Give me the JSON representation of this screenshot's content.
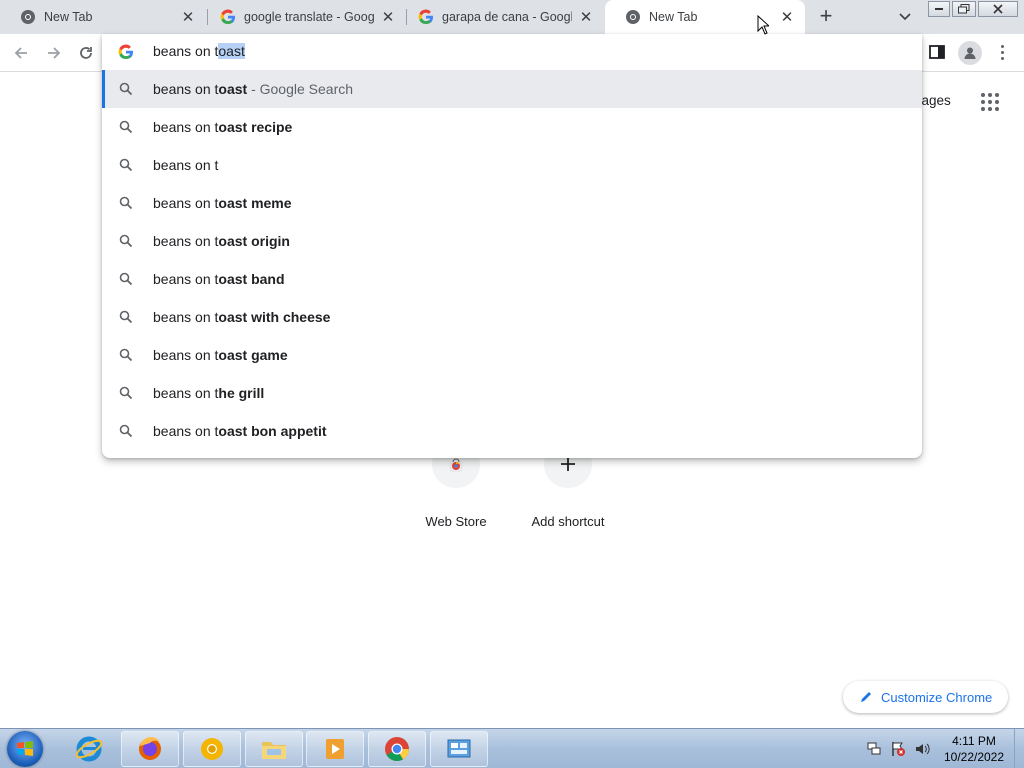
{
  "tabs": [
    {
      "title": "New Tab",
      "favicon": "chrome-icon",
      "active": false
    },
    {
      "title": "google translate - Google",
      "favicon": "google-g-icon",
      "active": false
    },
    {
      "title": "garapa de cana - Google",
      "favicon": "google-g-icon",
      "active": false
    },
    {
      "title": "New Tab",
      "favicon": "chrome-icon",
      "active": true
    }
  ],
  "omnibox": {
    "typed": "beans on t",
    "autocomplete_selected": "oast",
    "suggestions": [
      {
        "prefix": "beans on t",
        "bold": "oast",
        "suffix": " - Google Search",
        "highlighted": true
      },
      {
        "prefix": "beans on t",
        "bold": "oast recipe",
        "suffix": ""
      },
      {
        "prefix": "beans on t",
        "bold": "",
        "suffix": ""
      },
      {
        "prefix": "beans on t",
        "bold": "oast meme",
        "suffix": ""
      },
      {
        "prefix": "beans on t",
        "bold": "oast origin",
        "suffix": ""
      },
      {
        "prefix": "beans on t",
        "bold": "oast band",
        "suffix": ""
      },
      {
        "prefix": "beans on t",
        "bold": "oast with cheese",
        "suffix": ""
      },
      {
        "prefix": "beans on t",
        "bold": "oast game",
        "suffix": ""
      },
      {
        "prefix": "beans on t",
        "bold": "he grill",
        "suffix": ""
      },
      {
        "prefix": "beans on t",
        "bold": "oast bon appetit",
        "suffix": ""
      }
    ]
  },
  "ntp": {
    "images_link": "nages",
    "shortcuts": [
      {
        "label": "Web Store",
        "icon": "webstore-icon"
      },
      {
        "label": "Add shortcut",
        "icon": "plus-icon"
      }
    ],
    "customize_label": "Customize Chrome"
  },
  "taskbar": {
    "items": [
      "internet-explorer-icon",
      "firefox-icon",
      "chrome-canary-icon",
      "file-explorer-icon",
      "media-player-icon",
      "chrome-icon",
      "control-panel-icon"
    ],
    "clock_time": "4:11 PM",
    "clock_date": "10/22/2022"
  },
  "colors": {
    "accent": "#1a73e8",
    "tabstrip": "#dee1e6",
    "highlight_row": "#e8eaed",
    "selection": "#b6d1f5"
  }
}
